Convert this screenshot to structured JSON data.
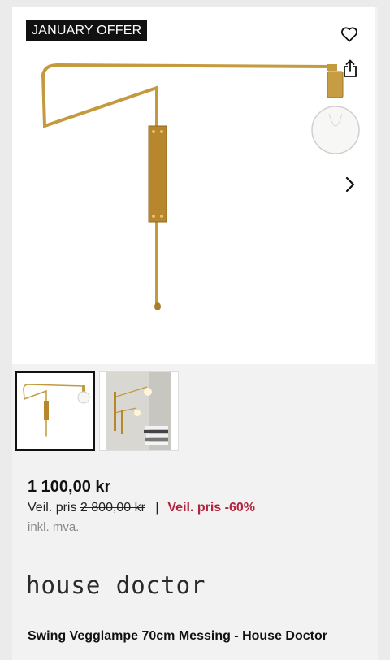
{
  "badge": {
    "text": "JANUARY OFFER"
  },
  "icons": {
    "wishlist": "heart-icon",
    "share": "share-icon",
    "next": "chevron-right-icon"
  },
  "gallery": {
    "thumbnails": [
      {
        "name": "thumbnail-lamp-product",
        "selected": true
      },
      {
        "name": "thumbnail-lamp-room",
        "selected": false
      }
    ]
  },
  "pricing": {
    "price": "1 100,00 kr",
    "ref_label": "Veil. pris",
    "ref_price": "2 800,00 kr",
    "separator": "|",
    "discount": "Veil. pris -60%",
    "vat": "inkl. mva."
  },
  "brand": {
    "logo_text": "house doctor"
  },
  "product": {
    "title": "Swing Vegglampe 70cm Messing - House Doctor"
  },
  "colors": {
    "discount": "#b0253d",
    "brass": "#c49a3e",
    "badge_bg": "#111111"
  }
}
